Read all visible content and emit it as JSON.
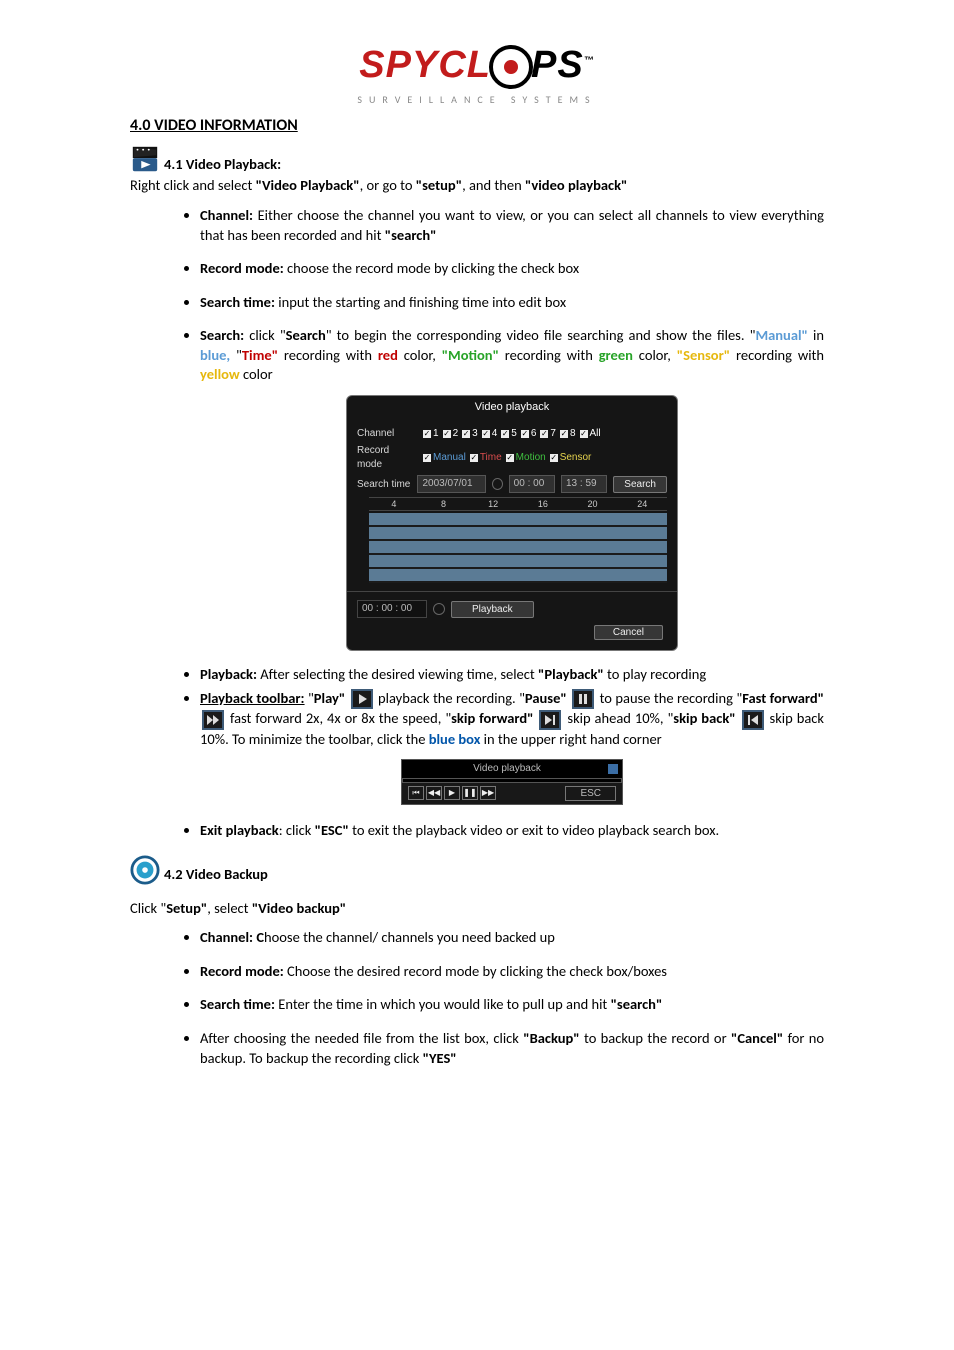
{
  "logo": {
    "line1_left": "SPYCL",
    "line1_right": "PS",
    "tm": "™",
    "line2": "SURVEILLANCE SYSTEMS"
  },
  "section_title": "4.0 VIDEO INFORMATION",
  "s41": {
    "heading": "4.1 Video Playback:",
    "intro_a": "Right click and select ",
    "intro_b": "\"Video Playback\"",
    "intro_c": ", or go to ",
    "intro_d": "\"setup\"",
    "intro_e": ", and then ",
    "intro_f": "\"video playback\"",
    "b_channel_h": "Channel:",
    "b_channel_t": "  Either choose the channel you want to view, or you can select all channels to view everything that has been recorded and hit ",
    "b_channel_q": "\"search\"",
    "b_record_h": "Record mode:",
    "b_record_t": "  choose the record mode by clicking the check box",
    "b_searchtime_h": "Search time:",
    "b_searchtime_t": "  input the starting and finishing time into edit box",
    "b_search_h": "Search:",
    "b_search_t1": "  click \"",
    "b_search_t2": "Search",
    "b_search_t3": "\" to begin the corresponding video file searching and show the files.  \"",
    "b_search_manual": "Manual\"",
    "b_search_t4": " in ",
    "b_search_blue": "blue,",
    "b_search_t5": " \"",
    "b_search_timeq": "Time\"",
    "b_search_t6": " recording with ",
    "b_search_red": "red",
    "b_search_t7": " color, ",
    "b_search_motionq": "\"Motion\"",
    "b_search_t8": " recording with ",
    "b_search_green": "green",
    "b_search_t9": " color, ",
    "b_search_sensorq": "\"Sensor\"",
    "b_search_t10": " recording with ",
    "b_search_yellow": "yellow",
    "b_search_t11": " color",
    "b_playback_h": "Playback:",
    "b_playback_t": "  After selecting the desired viewing time, select ",
    "b_playback_q": "\"Playback\"",
    "b_playback_t2": "  to play recording",
    "b_toolbar_h": "Playback toolbar:",
    "b_toolbar_t1": "   \"",
    "b_toolbar_play": "Play\"",
    "b_toolbar_t2": " playback the recording.  \"",
    "b_toolbar_pause": "Pause\"",
    "b_toolbar_t3": " to pause the recording \"",
    "b_toolbar_ff": "Fast forward\"",
    "b_toolbar_t4": " fast forward 2x, 4x or 8x the speed, \"",
    "b_toolbar_sf": "skip forward\"",
    "b_toolbar_t5": " skip ahead 10%, \"",
    "b_toolbar_sb": "skip back\"",
    "b_toolbar_t6": " skip back 10%.  To minimize the toolbar, click the ",
    "b_toolbar_bbox": "blue box",
    "b_toolbar_t7": " in the upper right hand corner",
    "b_exit_h": "Exit playback",
    "b_exit_t1": ":  click ",
    "b_exit_q": "\"ESC\"",
    "b_exit_t2": " to exit the playback video or exit to video playback search box."
  },
  "vp": {
    "title": "Video playback",
    "l_channel": "Channel",
    "l_record": "Record mode",
    "l_search": "Search time",
    "ch": [
      "1",
      "2",
      "3",
      "4",
      "5",
      "6",
      "7",
      "8",
      "All"
    ],
    "modes": {
      "manual": "Manual",
      "time": "Time",
      "motion": "Motion",
      "sensor": "Sensor"
    },
    "date": "2003/07/01",
    "t_from": "00 : 00",
    "t_to": "13 : 59",
    "btn_search": "Search",
    "hours": [
      "4",
      "8",
      "12",
      "16",
      "20",
      "24"
    ],
    "t_pb": "00 : 00 : 00",
    "btn_playback": "Playback",
    "btn_cancel": "Cancel"
  },
  "mini": {
    "title": "Video playback",
    "esc": "ESC"
  },
  "s42": {
    "heading": "4.2 Video Backup",
    "intro_a": "Click \"",
    "intro_b": "Setup\"",
    "intro_c": ", select ",
    "intro_d": "\"Video backup\"",
    "b_channel_h": "Channel:  C",
    "b_channel_t": "hoose the channel/ channels you need backed up",
    "b_record_h": "Record mode:",
    "b_record_t": "  Choose the desired record mode by clicking the check box/boxes",
    "b_searchtime_h": "Search time:",
    "b_searchtime_t": " Enter the time in which you would like to pull up and hit ",
    "b_searchtime_q": "\"search\"",
    "b_after_t1": "After choosing the needed file from the list box, click ",
    "b_after_q1": "\"Backup\"",
    "b_after_t2": " to backup the record or ",
    "b_after_q2": "\"Cancel\"",
    "b_after_t3": " for no backup.  To backup the recording click ",
    "b_after_q3": "\"YES\""
  }
}
